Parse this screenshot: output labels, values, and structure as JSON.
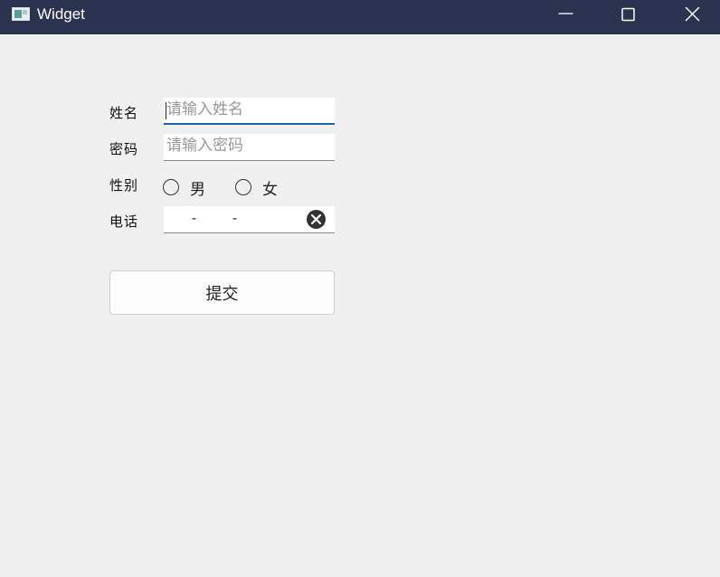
{
  "window": {
    "title": "Widget"
  },
  "icons": {
    "app": "app-window-icon",
    "minimize": "minimize-icon",
    "maximize": "maximize-icon",
    "close": "close-icon",
    "clear": "clear-circle-icon"
  },
  "form": {
    "name_label": "姓名",
    "name_placeholder": "请输入姓名",
    "password_label": "密码",
    "password_placeholder": "请输入密码",
    "gender_label": "性别",
    "gender_options": [
      "男",
      "女"
    ],
    "phone_label": "电话",
    "phone_mask_sep1": "-",
    "phone_mask_sep2": "-",
    "submit_label": "提交"
  },
  "colors": {
    "titlebar": "#2b3350",
    "focus_accent": "#1d64b8",
    "background": "#f0f0f0"
  }
}
